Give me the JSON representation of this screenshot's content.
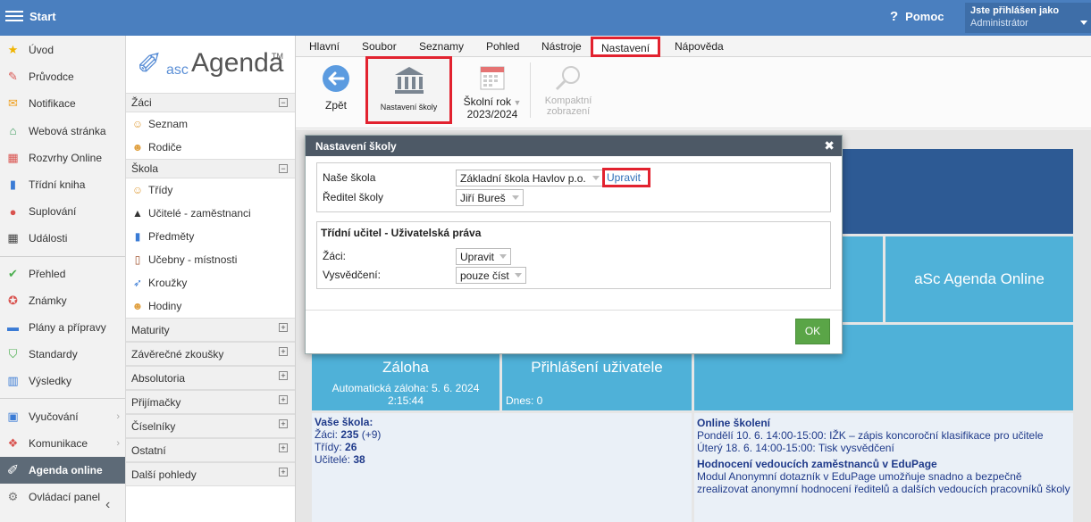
{
  "topbar": {
    "start_label": "Start",
    "help_label": "Pomoc",
    "user_line1": "Jste přihlášen jako",
    "user_line2": "Administrátor"
  },
  "leftnav": {
    "items": [
      {
        "label": "Úvod",
        "icon": "star-icon"
      },
      {
        "label": "Průvodce",
        "icon": "wand-icon"
      },
      {
        "label": "Notifikace",
        "icon": "envelope-icon"
      },
      {
        "label": "Webová stránka",
        "icon": "home-icon"
      },
      {
        "label": "Rozvrhy Online",
        "icon": "timetable-icon"
      },
      {
        "label": "Třídní kniha",
        "icon": "book-icon"
      },
      {
        "label": "Suplování",
        "icon": "substitution-icon"
      },
      {
        "label": "Události",
        "icon": "calendar-icon"
      },
      {
        "label": "Přehled",
        "icon": "check-icon"
      },
      {
        "label": "Známky",
        "icon": "grades-icon"
      },
      {
        "label": "Plány a přípravy",
        "icon": "briefcase-icon"
      },
      {
        "label": "Standardy",
        "icon": "shield-icon"
      },
      {
        "label": "Výsledky",
        "icon": "bar-chart-icon"
      },
      {
        "label": "Vyučování",
        "icon": "teaching-icon"
      },
      {
        "label": "Komunikace",
        "icon": "chat-icon"
      },
      {
        "label": "Agenda online",
        "icon": "pen-icon"
      },
      {
        "label": "Ovládací panel",
        "icon": "gear-icon"
      }
    ]
  },
  "module": {
    "logo_asc": "asc",
    "logo_agenda": "Agenda",
    "logo_tm": "TM",
    "zaci_header": "Žáci",
    "zaci_items": [
      "Seznam",
      "Rodiče"
    ],
    "skola_header": "Škola",
    "skola_items": [
      "Třídy",
      "Učitelé - zaměstnanci",
      "Předměty",
      "Učebny - místnosti",
      "Kroužky",
      "Hodiny"
    ],
    "collapsed_headers": [
      "Maturity",
      "Závěrečné zkoušky",
      "Absolutoria",
      "Přijímačky",
      "Číselníky",
      "Ostatní",
      "Další pohledy"
    ]
  },
  "ribbon": {
    "tabs": [
      "Hlavní",
      "Soubor",
      "Seznamy",
      "Pohled",
      "Nástroje",
      "Nastavení",
      "Nápověda"
    ],
    "back_label": "Zpět",
    "settings_label": "Nastavení školy",
    "year_label": "Školní rok",
    "year_value": "2023/2024",
    "compact_line1": "Kompaktní",
    "compact_line2": "zobrazení"
  },
  "dialog": {
    "title": "Nastavení školy",
    "nase_skola_label": "Naše škola",
    "nase_skola_value": "Základní škola Havlov p.o.",
    "upravit_link": "Upravit",
    "reditel_label": "Ředitel školy",
    "reditel_value": "Jiří Bureš",
    "section_title": "Třídní učitel - Uživatelská práva",
    "zaci_label": "Žáci:",
    "zaci_value": "Upravit",
    "vysvedceni_label": "Vysvědčení:",
    "vysvedceni_value": "pouze číst",
    "ok_label": "OK"
  },
  "dashboard": {
    "online_title": "aSc Agenda Online",
    "backup_title": "Záloha",
    "backup_line1": "Automatická záloha: 5. 6. 2024",
    "backup_line2": "2:15:44",
    "logins_title": "Přihlášení uživatele",
    "logins_today": "Dnes: 0",
    "school_title": "Vaše škola:",
    "pupils_label": "Žáci:",
    "pupils_value": "235",
    "pupils_delta": "(+9)",
    "classes_label": "Třídy:",
    "classes_value": "26",
    "teachers_label": "Učitelé:",
    "teachers_value": "38",
    "training_title": "Online školení",
    "training_1": "Pondělí 10. 6. 14:00-15:00: IŽK – zápis koncoroční klasifikace pro učitele",
    "training_2": "Úterý 18. 6. 14:00-15:00: Tisk vysvědčení",
    "eval_title": "Hodnocení vedoucích zaměstnanců v EduPage",
    "eval_text": "Modul Anonymní dotazník v EduPage umožňuje snadno a bezpečně zrealizovat anonymní hodnocení ředitelů a dalších vedoucích pracovníků školy"
  },
  "colors": {
    "topbar": "#4a7fbf",
    "tile_dark": "#2d5a94",
    "tile_light": "#4fb1d8",
    "ok_green": "#5aa547",
    "highlight_red": "#e2222f"
  }
}
